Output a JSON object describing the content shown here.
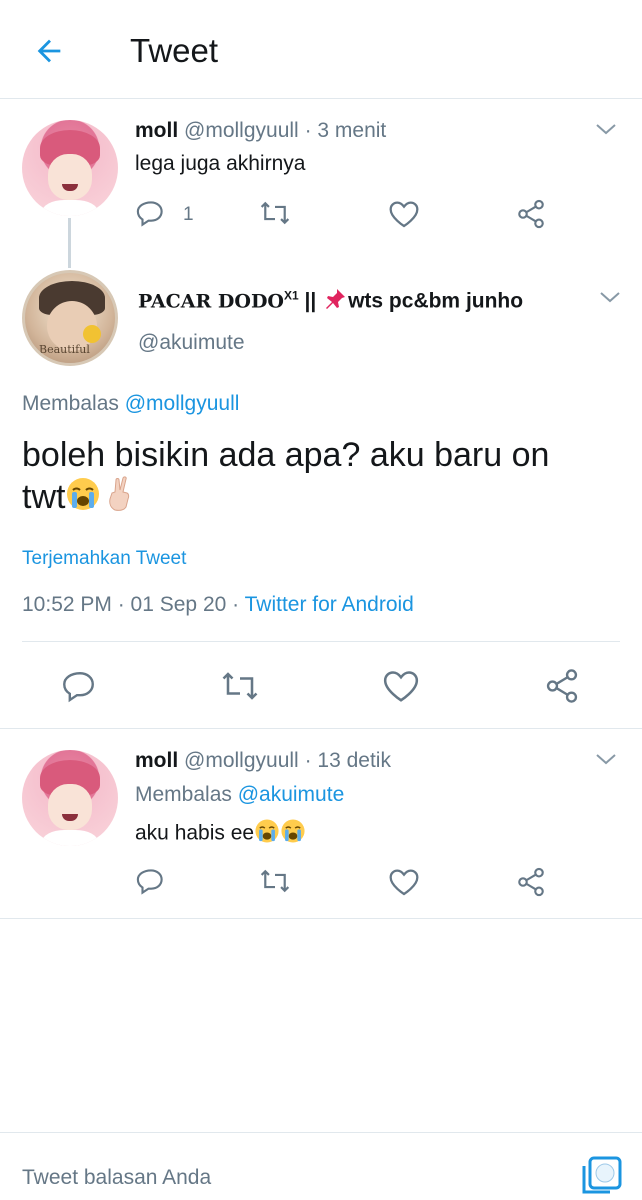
{
  "header": {
    "title": "Tweet"
  },
  "parent_tweet": {
    "name": "moll",
    "handle": "@mollgyuull",
    "time": "· 3 menit",
    "text": "lega juga akhirnya",
    "reply_count": "1"
  },
  "main_tweet": {
    "name_prefix": "PACAR DODO",
    "name_sup": "X1",
    "name_sep": " || ",
    "name_suffix": "wts pc&bm junho",
    "handle": "@akuimute",
    "reply_prefix": "Membalas",
    "reply_to": "@mollgyuull",
    "text_line1": "boleh bisikin ada apa? aku baru on",
    "text_line2": "twt",
    "avatar_caption": "Beautiful",
    "translate": "Terjemahkan Tweet",
    "timestamp": "10:52 PM · 01 Sep 20 ·",
    "source": "Twitter for Android"
  },
  "reply_tweet": {
    "name": "moll",
    "handle": "@mollgyuull",
    "time": "· 13 detik",
    "reply_prefix": "Membalas",
    "reply_to": "@akuimute",
    "text": "aku habis ee"
  },
  "composer": {
    "placeholder": "Tweet balasan Anda"
  },
  "colors": {
    "accent": "#1b95e0",
    "text": "#14171a",
    "muted": "#657786"
  }
}
